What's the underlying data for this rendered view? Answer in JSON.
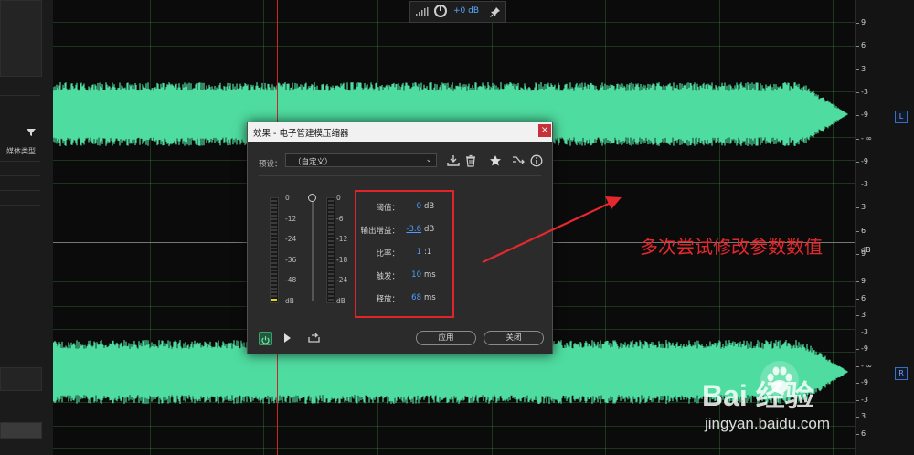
{
  "toolbar": {
    "volume": "+0 dB"
  },
  "sidebar": {
    "media_type_label": "媒体类型"
  },
  "ruler": {
    "top_ticks": [
      "9",
      "6",
      "3",
      "-3",
      "-9",
      "- ∞",
      "-9",
      "-3",
      "3",
      "6",
      "9"
    ],
    "unit": "dB",
    "bottom_ticks": [
      "9",
      "6",
      "3",
      "-3",
      "-9",
      "- ∞",
      "-9",
      "-3",
      "3",
      "6"
    ],
    "channel_left": "L",
    "channel_right": "R"
  },
  "dialog": {
    "title": "效果 - 电子管建模压缩器",
    "close_glyph": "×",
    "preset_label": "预设：",
    "preset_value": "（自定义）",
    "meter_in_labels": [
      "0",
      "-12",
      "-24",
      "-36",
      "-48",
      "dB"
    ],
    "meter_out_labels": [
      "0",
      "-6",
      "-12",
      "-18",
      "-24",
      "dB"
    ],
    "params": [
      {
        "label": "阈值：",
        "value": "0",
        "unit": "dB"
      },
      {
        "label": "输出增益：",
        "value": "-3.6",
        "unit": "dB"
      },
      {
        "label": "比率：",
        "value": "1",
        "unit": ":1"
      },
      {
        "label": "触发：",
        "value": "10",
        "unit": "ms"
      },
      {
        "label": "释放：",
        "value": "68",
        "unit": "ms"
      }
    ],
    "apply_label": "应用",
    "close_label": "关闭"
  },
  "annotation": {
    "text": "多次尝试修改参数数值",
    "color": "#e4282d"
  },
  "watermark": {
    "brand": "Bai  经验",
    "url": "jingyan.baidu.com"
  },
  "colors": {
    "waveform": "#4fdca0",
    "accent_blue": "#4c9dff",
    "highlight_red": "#e0242a"
  }
}
